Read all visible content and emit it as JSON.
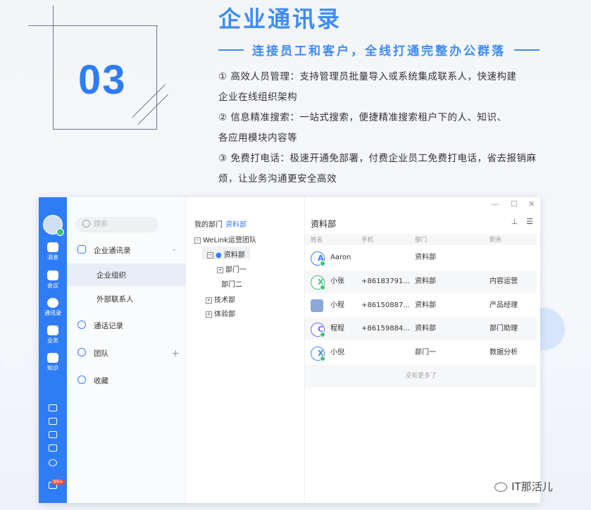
{
  "hero": {
    "number": "03",
    "title": "企业通讯录",
    "subtitle": "连接员工和客户，全线打通完整办公群落",
    "lines": [
      "① 高效人员管理：支持管理员批量导入或系统集成联系人，快速构建",
      "企业在线组织架构",
      "② 信息精准搜索：一站式搜索，便捷精准搜索租户下的人、知识、",
      "各应用模块内容等",
      "③ 免费打电话：极速开通免部署，付费企业员工免费打电话，省去报销麻",
      "烦，让业务沟通更安全高效"
    ]
  },
  "rail": {
    "items": [
      "消息",
      "会议",
      "通讯录",
      "业务",
      "知识"
    ],
    "active": "通讯录",
    "badge": "99+"
  },
  "contacts_nav": {
    "search_placeholder": "搜索",
    "section": "企业通讯录",
    "sub_items": [
      "企业组织",
      "外部联系人"
    ],
    "active_sub": "企业组织",
    "items": [
      "通话记录",
      "团队",
      "收藏"
    ]
  },
  "org_tree": {
    "header_label": "我的部门",
    "header_link": "资料部",
    "root": "WeLink运营团队",
    "selected": "资料部",
    "nodes": [
      "资料部",
      "部门一",
      "部门二",
      "技术部",
      "体验部"
    ]
  },
  "dept_panel": {
    "title": "资料部",
    "window_controls": [
      "—",
      "☐",
      "✕"
    ],
    "columns": [
      "姓名",
      "手机",
      "部门",
      "职务"
    ],
    "rows": [
      {
        "initial": "A",
        "color": "#2f7df6",
        "name": "Aaron",
        "phone": "",
        "dept": "资料部",
        "role": ""
      },
      {
        "initial": "X",
        "color": "#3ec27a",
        "name": "小张",
        "phone": "+86183791...",
        "dept": "资料部",
        "role": "内容运营"
      },
      {
        "initial": "",
        "color": "#8aa8d8",
        "name": "小程",
        "phone": "+86150887...",
        "dept": "资料部",
        "role": "产品经理"
      },
      {
        "initial": "C",
        "color": "#7a5cf0",
        "name": "程程",
        "phone": "+86159884...",
        "dept": "资料部",
        "role": "部门助理"
      },
      {
        "initial": "X",
        "color": "#3a8ef0",
        "name": "小倪",
        "phone": "",
        "dept": "部门一",
        "role": "数据分析"
      }
    ],
    "no_more": "没有更多了"
  },
  "watermark": "IT那活儿"
}
